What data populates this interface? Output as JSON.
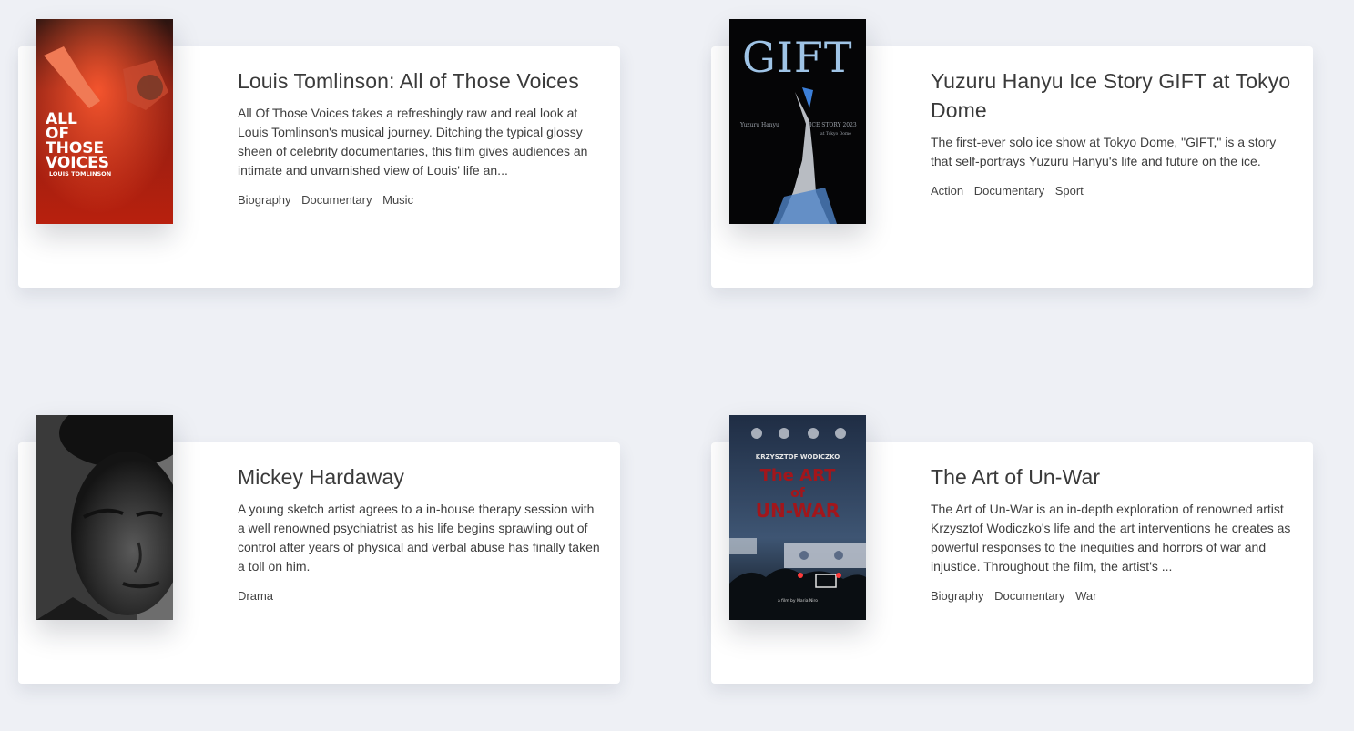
{
  "movies": [
    {
      "title": "Louis Tomlinson: All of Those Voices",
      "description": "All Of Those Voices takes a refreshingly raw and real look at Louis Tomlinson's musical journey. Ditching the typical glossy sheen of celebrity documentaries, this film gives audiences an intimate and unvarnished view of Louis' life an...",
      "genres": [
        "Biography",
        "Documentary",
        "Music"
      ],
      "poster": {
        "line1": "ALL",
        "line2": "OF",
        "line3": "THOSE",
        "line4": "VOICES",
        "line5": "LOUIS TOMLINSON"
      }
    },
    {
      "title": "Yuzuru Hanyu Ice Story GIFT at Tokyo Dome",
      "description": "The first-ever solo ice show at Tokyo Dome, \"GIFT,\" is a story that self-portrays Yuzuru Hanyu's life and future on the ice.",
      "genres": [
        "Action",
        "Documentary",
        "Sport"
      ],
      "poster": {
        "big": "GIFT",
        "left": "Yuzuru Hanyu",
        "right": "ICE STORY 2023",
        "sub": "at Tokyo Dome"
      }
    },
    {
      "title": "Mickey Hardaway",
      "description": "A young sketch artist agrees to a in-house therapy session with a well renowned psychiatrist as his life begins sprawling out of control after years of physical and verbal abuse has finally taken a toll on him.",
      "genres": [
        "Drama"
      ]
    },
    {
      "title": "The Art of Un-War",
      "description": "The Art of Un-War is an in-depth exploration of renowned artist Krzysztof Wodiczko's life and the art interventions he creates as powerful responses to the inequities and horrors of war and injustice. Throughout the film, the artist's ...",
      "genres": [
        "Biography",
        "Documentary",
        "War"
      ],
      "poster": {
        "top": "KRZYSZTOF WODICZKO",
        "l1": "The ART",
        "l2": "of",
        "l3": "UN-WAR",
        "credit": "a film by Maria Niro"
      }
    }
  ],
  "colors": {
    "background": "#eef0f5",
    "card": "#ffffff",
    "text": "#3a3a3a"
  }
}
